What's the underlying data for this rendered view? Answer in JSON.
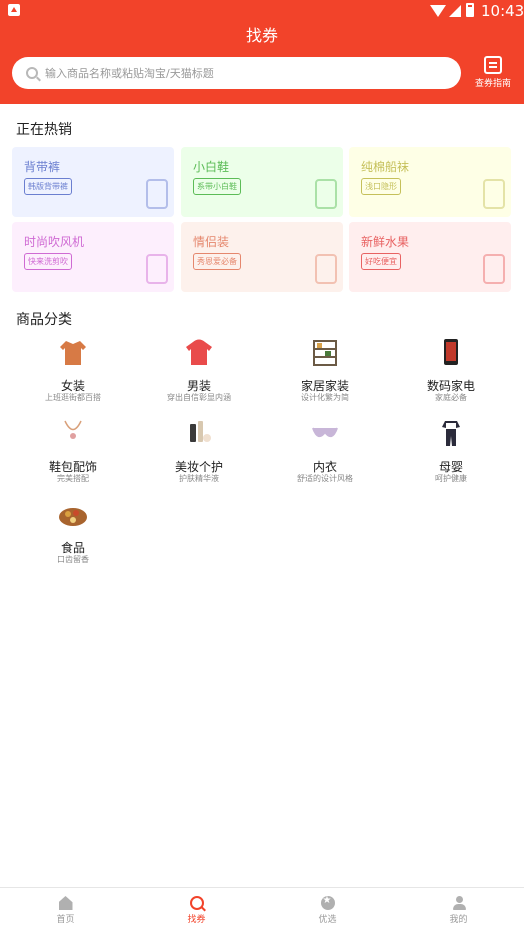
{
  "status_bar": {
    "time": "10:43"
  },
  "header": {
    "title": "找券",
    "search_placeholder": "输入商品名称或粘贴淘宝/天猫标题",
    "guide_label": "查券指南"
  },
  "hot": {
    "title": "正在热销",
    "cards": [
      {
        "name": "背带裤",
        "tag": "韩版背带裤",
        "bg": "#eef2ff",
        "color": "#6b7fd0"
      },
      {
        "name": "小白鞋",
        "tag": "系带小白鞋",
        "bg": "#ecffe9",
        "color": "#5cbc57"
      },
      {
        "name": "纯棉船袜",
        "tag": "浅口隐形",
        "bg": "#feffe6",
        "color": "#c5c05a"
      },
      {
        "name": "时尚吹风机",
        "tag": "快来洗剪吹",
        "bg": "#fdeffd",
        "color": "#cf6ad3"
      },
      {
        "name": "情侣装",
        "tag": "秀恩爱必备",
        "bg": "#fdf1ec",
        "color": "#e5876d"
      },
      {
        "name": "新鲜水果",
        "tag": "好吃便宜",
        "bg": "#ffeeee",
        "color": "#e86262"
      }
    ]
  },
  "categories": {
    "title": "商品分类",
    "items": [
      {
        "name": "女装",
        "sub": "上班逛街都百搭",
        "icon": "coat-icon",
        "color": "#d77a45"
      },
      {
        "name": "男装",
        "sub": "穿出自信彰显内涵",
        "icon": "hoodie-icon",
        "color": "#e94b4b"
      },
      {
        "name": "家居家装",
        "sub": "设计化繁为简",
        "icon": "shelf-icon",
        "color": "#6b5a45"
      },
      {
        "name": "数码家电",
        "sub": "家庭必备",
        "icon": "phone-icon",
        "color": "#222222"
      },
      {
        "name": "鞋包配饰",
        "sub": "完美搭配",
        "icon": "necklace-icon",
        "color": "#d9a07a"
      },
      {
        "name": "美妆个护",
        "sub": "护肤精华液",
        "icon": "cosmetics-icon",
        "color": "#3a3a3a"
      },
      {
        "name": "内衣",
        "sub": "舒适的设计风格",
        "icon": "bra-icon",
        "color": "#c8b6d8"
      },
      {
        "name": "母婴",
        "sub": "呵护健康",
        "icon": "baby-clothes-icon",
        "color": "#2b2b3b"
      },
      {
        "name": "食品",
        "sub": "口齿留香",
        "icon": "food-icon",
        "color": "#a8642e"
      }
    ]
  },
  "tabs": [
    {
      "label": "首页",
      "icon": "home-icon",
      "active": false
    },
    {
      "label": "找券",
      "icon": "find-icon",
      "active": true
    },
    {
      "label": "优选",
      "icon": "star-icon",
      "active": false
    },
    {
      "label": "我的",
      "icon": "user-icon",
      "active": false
    }
  ]
}
